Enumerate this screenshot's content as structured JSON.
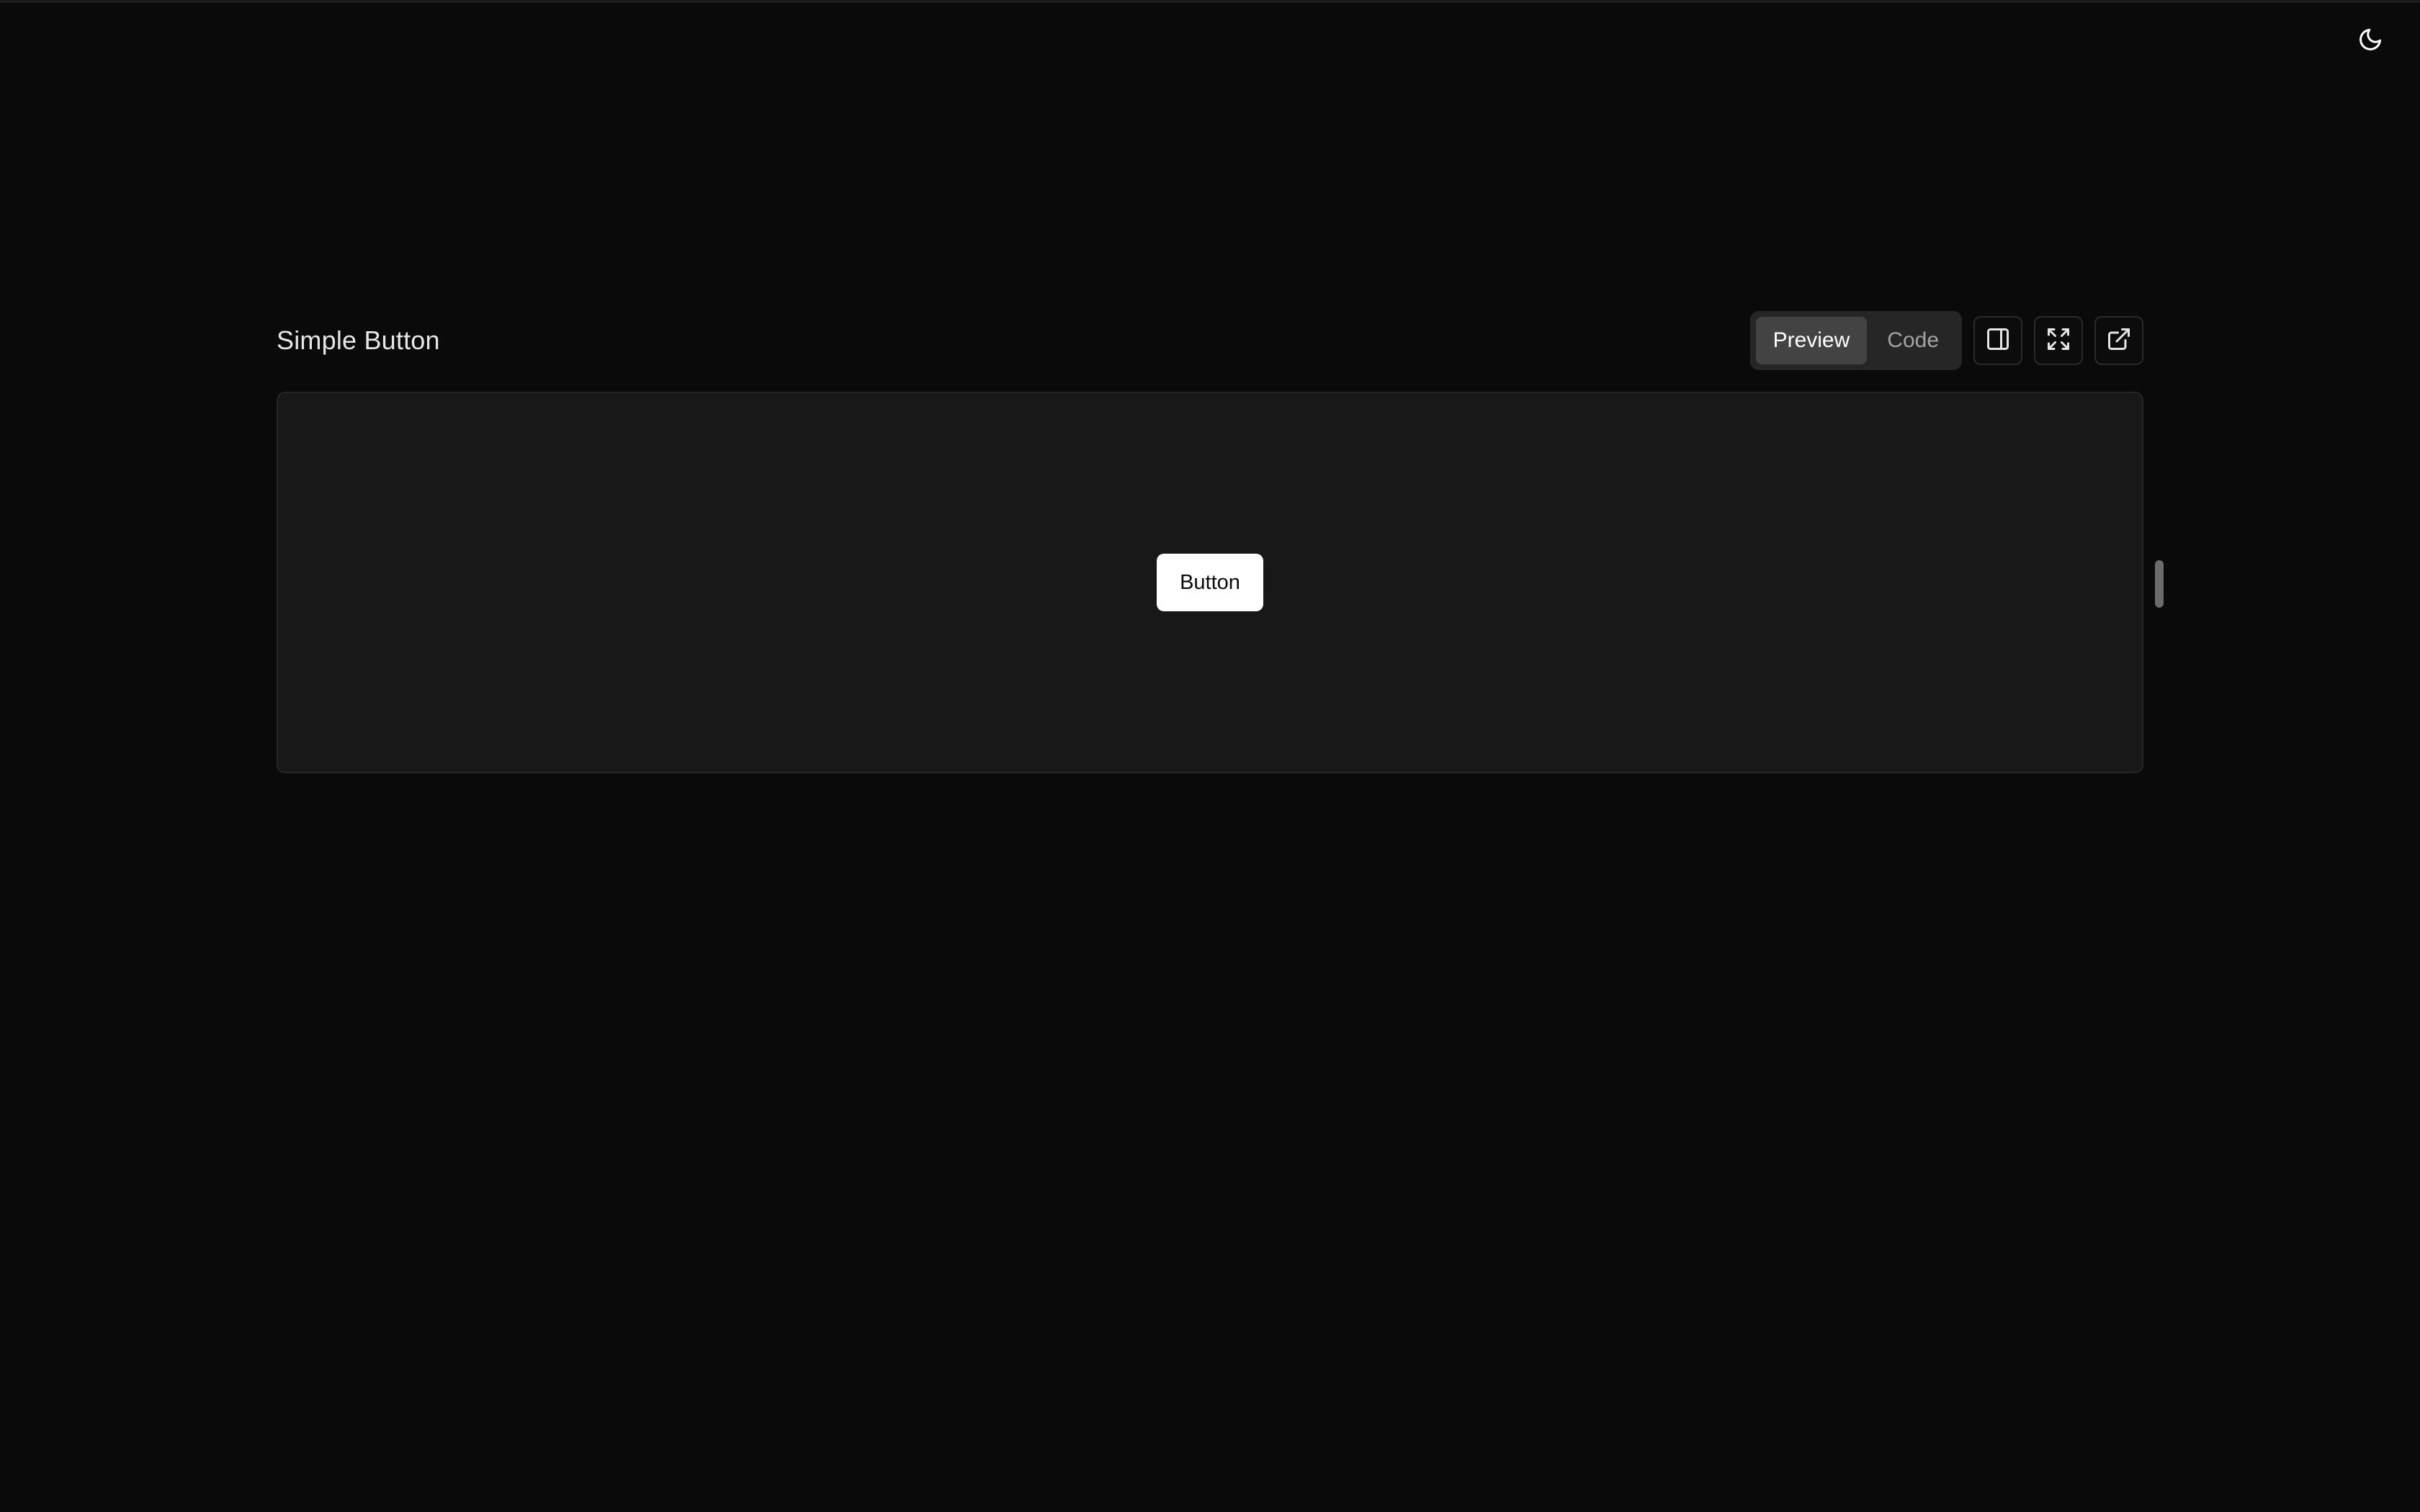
{
  "block": {
    "title": "Simple Button",
    "tabs": [
      {
        "label": "Preview",
        "active": true
      },
      {
        "label": "Code",
        "active": false
      }
    ],
    "toolbar_icons": [
      "sidebar-panel-icon",
      "maximize-icon",
      "external-link-icon"
    ]
  },
  "preview": {
    "button_label": "Button"
  },
  "header": {
    "theme_icon": "moon-icon"
  },
  "colors": {
    "background": "#0a0a0a",
    "preview_background": "#181818",
    "active_tab": "#434343",
    "demo_button": "#ffffff"
  }
}
